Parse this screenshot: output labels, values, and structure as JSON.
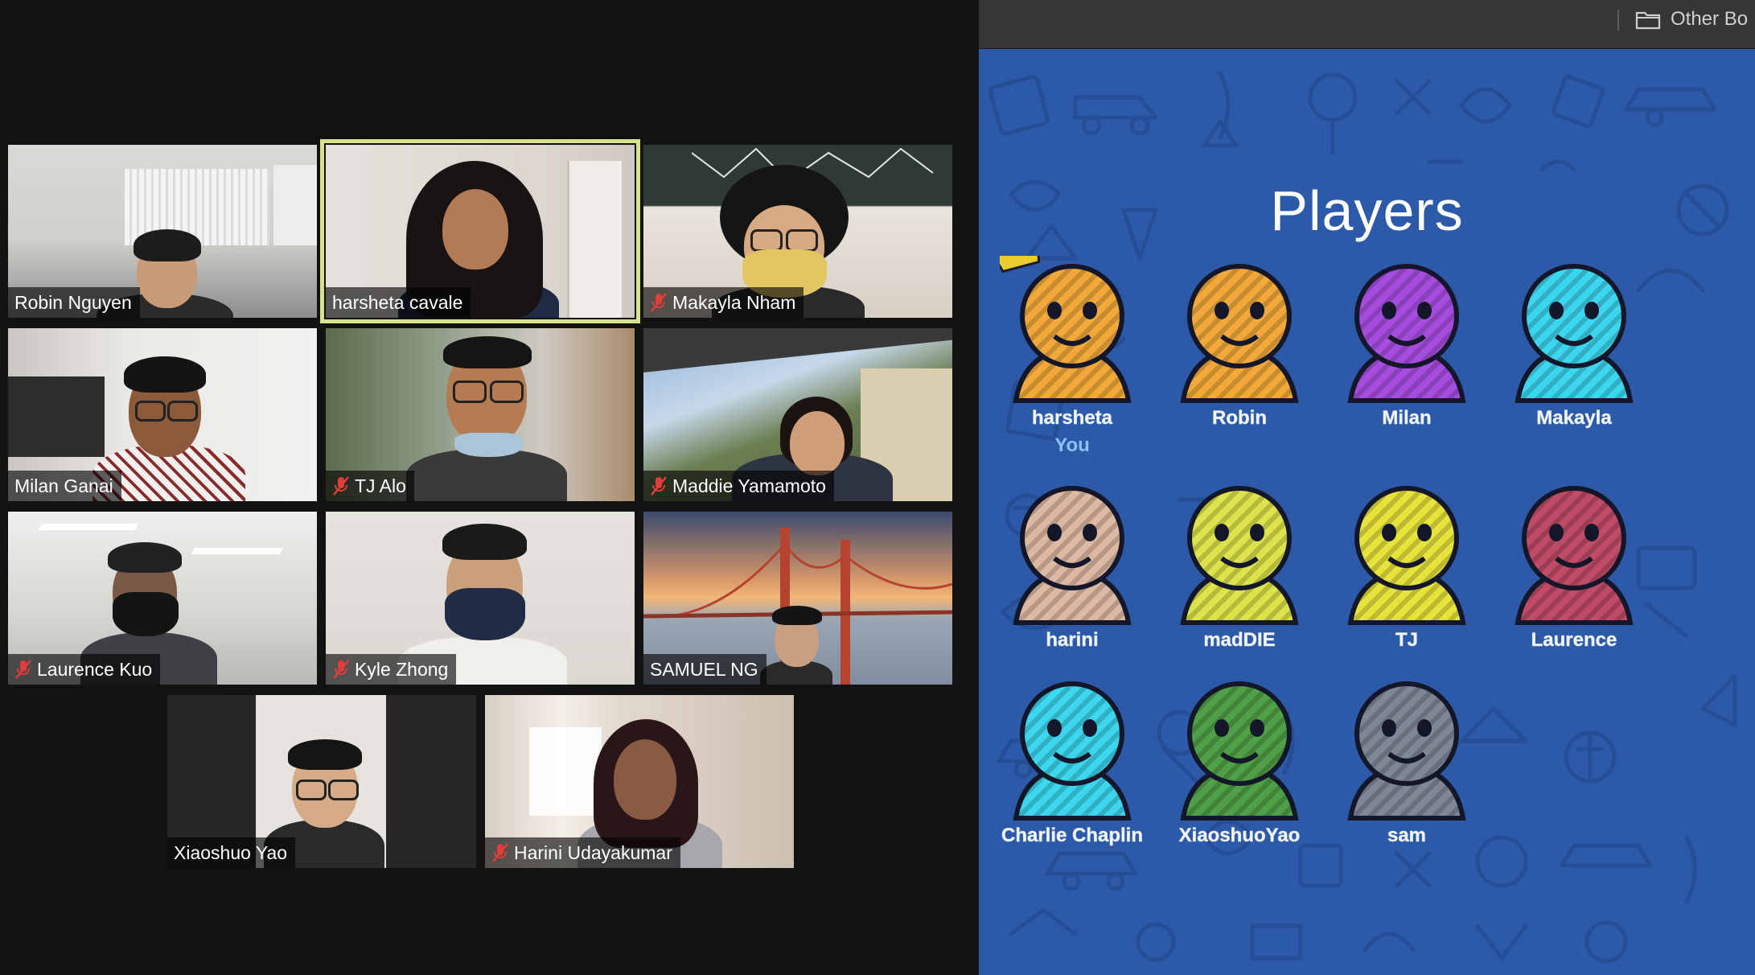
{
  "gallery": {
    "participants": [
      {
        "name": "Robin Nguyen",
        "muted": false,
        "active": false
      },
      {
        "name": "harsheta cavale",
        "muted": false,
        "active": true
      },
      {
        "name": "Makayla Nham",
        "muted": true,
        "active": false
      },
      {
        "name": "Milan Ganai",
        "muted": false,
        "active": false
      },
      {
        "name": "TJ Alo",
        "muted": true,
        "active": false
      },
      {
        "name": "Maddie Yamamoto",
        "muted": true,
        "active": false
      },
      {
        "name": "Laurence Kuo",
        "muted": true,
        "active": false
      },
      {
        "name": "Kyle Zhong",
        "muted": true,
        "active": false
      },
      {
        "name": "SAMUEL NG",
        "muted": false,
        "active": false
      },
      {
        "name": "Xiaoshuo Yao",
        "muted": false,
        "active": false
      },
      {
        "name": "Harini Udayakumar",
        "muted": true,
        "active": false
      }
    ]
  },
  "browser": {
    "bookmark": "Other Bo",
    "bookmark_icon": "folder-icon"
  },
  "game": {
    "title": "Players",
    "you_label": "You",
    "players": [
      {
        "name": "harsheta",
        "color": "#f3a93a",
        "crown": true,
        "you": true
      },
      {
        "name": "Robin",
        "color": "#f3a93a"
      },
      {
        "name": "Milan",
        "color": "#a64de0"
      },
      {
        "name": "Makayla",
        "color": "#3cd6ee"
      },
      {
        "name": "harini",
        "color": "#ddb9a3"
      },
      {
        "name": "madDIE",
        "color": "#dde34b"
      },
      {
        "name": "TJ",
        "color": "#e6e33c"
      },
      {
        "name": "Laurence",
        "color": "#c04b66"
      },
      {
        "name": "Charlie Chaplin",
        "color": "#3cd6ee"
      },
      {
        "name": "XiaoshuoYao",
        "color": "#4fa046"
      },
      {
        "name": "sam",
        "color": "#7f8796"
      }
    ]
  }
}
